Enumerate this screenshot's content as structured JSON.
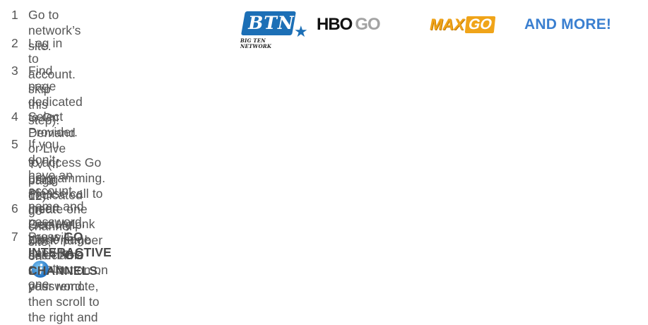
{
  "logos": {
    "btn_text": "BTN",
    "btn_tagline": "BIG TEN NETWORK",
    "hbo_part1": "HBO",
    "hbo_part2": "GO",
    "max_part1": "MAX",
    "max_part2": "GO",
    "more_text": "AND MORE!",
    "colors": {
      "btn_blue": "#1c6fb6",
      "max_orange": "#f0a419",
      "more_blue": "#3a7fd0"
    }
  },
  "steps": [
    {
      "number": "1",
      "lines": [
        "Go to network’s site."
      ]
    },
    {
      "number": "2",
      "lines": [
        "Log in to account."
      ]
    },
    {
      "number": "3",
      "lines": [
        "Find page dedicated to On Demand or Live TV (If using dedicated go channel site,",
        "skip this step)."
      ]
    },
    {
      "number": "4",
      "lines": [
        "Select Provider."
      ]
    },
    {
      "number": "5",
      "lines": [
        "If you don’t have an account name and password, you will need to create one",
        "to access Go programming. Please call to create one (see Help Desk number on",
        "page 12)."
      ]
    },
    {
      "number": "6",
      "lines": [
        "Insert CenturyLink home page username and password."
      ]
    },
    {
      "number": "7",
      "line1_prefix": "Press ",
      "line1_bold": "GO INTERACTIVE",
      "line1_suffix": " button on your remote, then scroll to the right and",
      "line2_prefix": "select ",
      "line2_bold": "GO CHANNELS",
      "line2_suffix": ".",
      "icon": "go-interactive-icon"
    }
  ]
}
